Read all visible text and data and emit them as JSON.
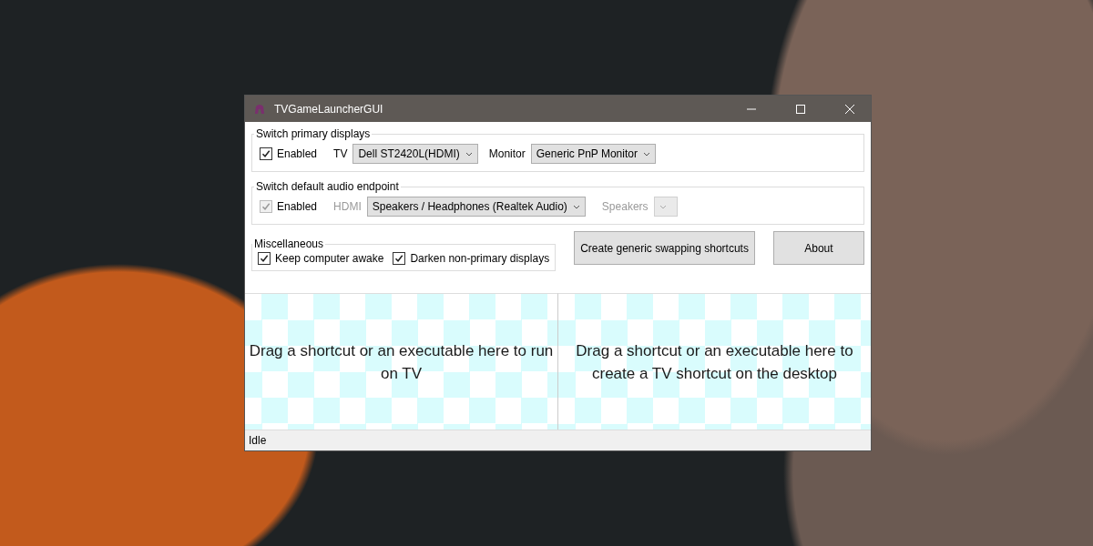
{
  "window": {
    "title": "TVGameLauncherGUI"
  },
  "display_group": {
    "title": "Switch primary displays",
    "disabled": false,
    "enabled": {
      "label": "Enabled",
      "checked": true
    },
    "tv": {
      "label": "TV",
      "value": "Dell ST2420L(HDMI)"
    },
    "monitor": {
      "label": "Monitor",
      "value": "Generic PnP Monitor"
    }
  },
  "audio_group": {
    "title": "Switch default audio endpoint",
    "disabled": true,
    "enabled": {
      "label": "Enabled",
      "checked": true
    },
    "hdmi": {
      "label": "HDMI",
      "value": "Speakers / Headphones (Realtek Audio)"
    },
    "speakers": {
      "label": "Speakers"
    }
  },
  "misc_group": {
    "title": "Miscellaneous",
    "options": [
      {
        "label": "Keep computer awake",
        "checked": true
      },
      {
        "label": "Darken non-primary displays",
        "checked": true
      }
    ]
  },
  "buttons": [
    "Create generic swapping shortcuts",
    "About"
  ],
  "drop_zones": [
    "Drag a shortcut or an executable here to run on TV",
    "Drag a shortcut or an executable here to create a TV shortcut on the desktop"
  ],
  "status_bar": "Idle"
}
